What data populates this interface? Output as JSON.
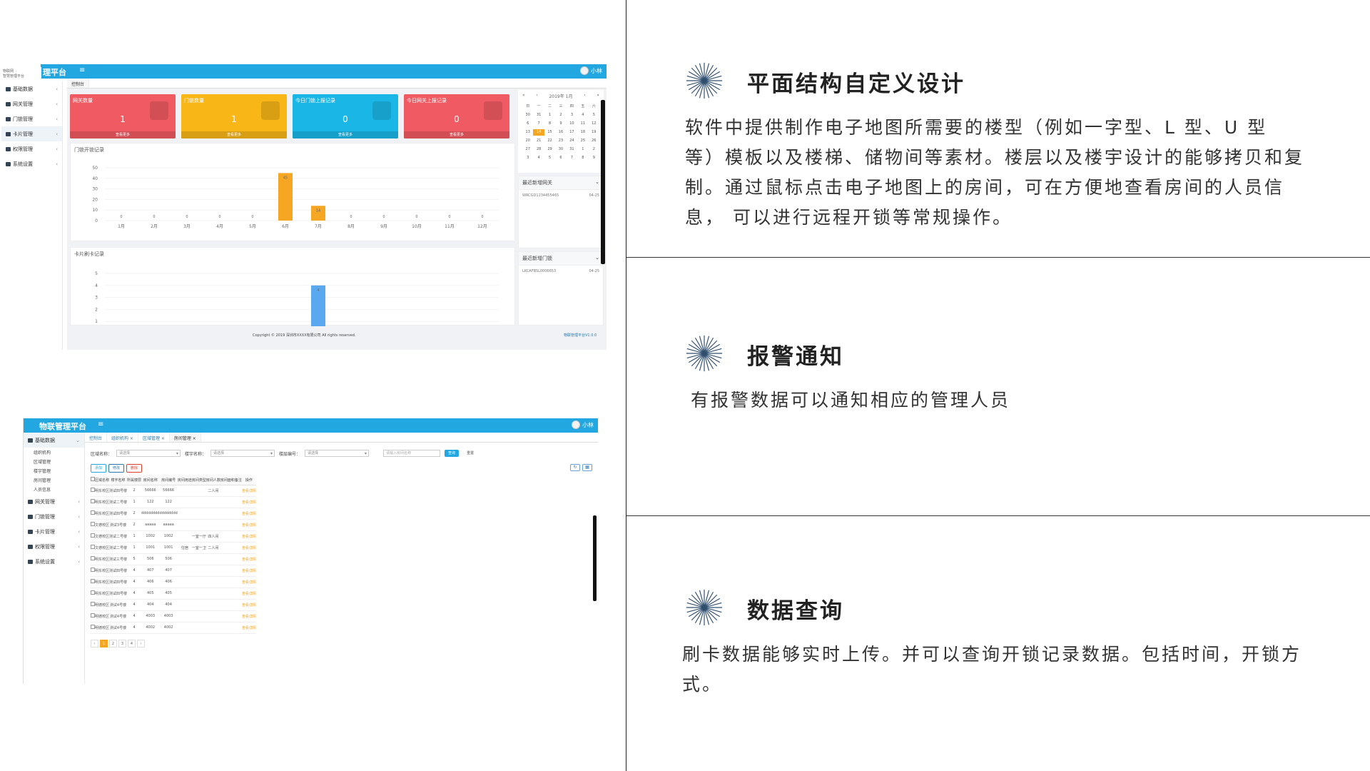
{
  "dashboard": {
    "brand": "理平台",
    "logo_line1": "物联网",
    "logo_line2": "智慧管理平台",
    "menu_toggle": "≡",
    "user": "小林",
    "sidebar": [
      "基础数据",
      "网关管理",
      "门锁管理",
      "卡片管理",
      "权限管理",
      "系统设置"
    ],
    "tab": "控制台",
    "cards": [
      {
        "title": "网关数量",
        "value": "1",
        "footer": "查看更多",
        "color": "#f05a62"
      },
      {
        "title": "门锁数量",
        "value": "1",
        "footer": "查看更多",
        "color": "#f8b617"
      },
      {
        "title": "今日门锁上报记录",
        "value": "0",
        "footer": "查看更多",
        "color": "#1ab7e6"
      },
      {
        "title": "今日网关上报记录",
        "value": "0",
        "footer": "查看更多",
        "color": "#f05a62"
      }
    ],
    "chart1": {
      "title": "门锁开锁记录",
      "type": "bar",
      "categories": [
        "1月",
        "2月",
        "3月",
        "4月",
        "5月",
        "6月",
        "7月",
        "8月",
        "9月",
        "10月",
        "11月",
        "12月"
      ],
      "values": [
        0,
        0,
        0,
        0,
        0,
        45,
        14,
        0,
        0,
        0,
        0,
        0
      ],
      "yticks": [
        "50",
        "40",
        "30",
        "20",
        "10",
        "0"
      ],
      "ylim": [
        0,
        50
      ],
      "color": "#f5a623"
    },
    "chart2": {
      "title": "卡片刷卡记录",
      "type": "bar",
      "values": [
        0,
        0,
        0,
        0,
        0,
        0,
        4,
        0,
        0,
        0,
        0,
        0
      ],
      "yticks": [
        "5",
        "4",
        "3",
        "2",
        "1"
      ],
      "ylim": [
        0,
        5
      ],
      "color": "#5aa9f0"
    },
    "calendar": {
      "month": "2019年 1月",
      "weekdays": [
        "日",
        "一",
        "二",
        "三",
        "四",
        "五",
        "六"
      ],
      "days": [
        "30",
        "31",
        "1",
        "2",
        "3",
        "4",
        "5",
        "6",
        "7",
        "8",
        "9",
        "10",
        "11",
        "12",
        "13",
        "14",
        "15",
        "16",
        "17",
        "18",
        "19",
        "20",
        "21",
        "22",
        "23",
        "24",
        "25",
        "26",
        "27",
        "28",
        "29",
        "30",
        "31",
        "1",
        "2",
        "3",
        "4",
        "5",
        "6",
        "7",
        "8",
        "9"
      ],
      "today_index": 15
    },
    "recent_gateway": {
      "title": "最近新增网关",
      "item": "WRCGD1234455465",
      "time": "04-25"
    },
    "recent_lock": {
      "title": "最近新增门锁",
      "item": "LKCAFBSL0006653",
      "time": "04-25"
    },
    "copyright": "Copyright © 2019 深圳市XXXX有限公司 All rights reserved.",
    "version": "物联管理平台V1.0.0"
  },
  "roomlist": {
    "brand": "物联管理平台",
    "menu_toggle": "≡",
    "user": "小林",
    "sidebar": {
      "group": "基础数据",
      "subs": [
        "组织机构",
        "区域管理",
        "楼宇管理",
        "房间管理",
        "人员信息"
      ],
      "items": [
        "网关管理",
        "门锁管理",
        "卡片管理",
        "权限管理",
        "系统设置"
      ]
    },
    "tabs": [
      "控制台",
      "组织机构 ×",
      "区域管理 ×",
      "房间管理 ×"
    ],
    "filters": {
      "area_label": "区域名称：",
      "area_value": "请选择",
      "building_label": "楼宇名称：",
      "building_value": "请选择",
      "floor_label": "楼层编号：",
      "floor_value": "请选择",
      "room_placeholder": "请输入房间名称",
      "query": "查询",
      "reset": "重置"
    },
    "actions": {
      "add": "添加",
      "edit": "修改",
      "delete": "删除"
    },
    "columns": [
      "",
      "区域名称",
      "楼宇名称",
      "所属楼层",
      "房间名称",
      "房间编号",
      "房间用途",
      "房间类型",
      "房间人数",
      "房间面积",
      "备注",
      "操作"
    ],
    "rows": [
      [
        "明东校区",
        "测试四号楼",
        "2",
        "56666",
        "56666",
        "",
        "",
        "二人间",
        "",
        "",
        "查看详情"
      ],
      [
        "明东校区",
        "测试二号楼",
        "1",
        "122",
        "122",
        "",
        "",
        "",
        "",
        "",
        "查看详情"
      ],
      [
        "明东校区",
        "测试四号楼",
        "2",
        "dddddddd",
        "dddddddd",
        "",
        "",
        "",
        "",
        "",
        "查看详情"
      ],
      [
        "文德校区",
        "测试3号楼",
        "2",
        "aaaaa",
        "aaaaa",
        "",
        "",
        "",
        "",
        "",
        "查看详情"
      ],
      [
        "文德校区",
        "测试二号楼",
        "1",
        "1002",
        "1002",
        "",
        "一室一厅",
        "四人间",
        "",
        "",
        "查看详情"
      ],
      [
        "文德校区",
        "测试二号楼",
        "1",
        "1001",
        "1001",
        "住宿",
        "一室一卫",
        "二人间",
        "",
        "",
        "查看详情"
      ],
      [
        "明东校区",
        "测试三号楼",
        "5",
        "506",
        "506",
        "",
        "",
        "",
        "",
        "",
        "查看详情"
      ],
      [
        "明东校区",
        "测试四号楼",
        "4",
        "407",
        "407",
        "",
        "",
        "",
        "",
        "",
        "查看详情"
      ],
      [
        "明东校区",
        "测试四号楼",
        "4",
        "406",
        "406",
        "",
        "",
        "",
        "",
        "",
        "查看详情"
      ],
      [
        "明东校区",
        "测试四号楼",
        "4",
        "405",
        "405",
        "",
        "",
        "",
        "",
        "",
        "查看详情"
      ],
      [
        "明德校区",
        "测试4号楼",
        "4",
        "404",
        "404",
        "",
        "",
        "",
        "",
        "",
        "查看详情"
      ],
      [
        "明德校区",
        "测试4号楼",
        "4",
        "4003",
        "4003",
        "",
        "",
        "",
        "",
        "",
        "查看详情"
      ],
      [
        "明德校区",
        "测试4号楼",
        "4",
        "4002",
        "4002",
        "",
        "",
        "",
        "",
        "",
        "查看详情"
      ]
    ],
    "pages": [
      "‹",
      "1",
      "2",
      "3",
      "4",
      "›"
    ]
  },
  "features": [
    {
      "title": "平面结构自定义设计",
      "body": "软件中提供制作电子地图所需要的楼型（例如一字型、L 型、U 型 等）模板以及楼梯、储物间等素材。楼层以及楼宇设计的能够拷贝和复制。通过鼠标点击电子地图上的房间，可在方便地查看房间的人员信息， 可以进行远程开锁等常规操作。"
    },
    {
      "title": "报警通知",
      "body": "有报警数据可以通知相应的管理人员"
    },
    {
      "title": "数据查询",
      "body": "刷卡数据能够实时上传。并可以查询开锁记录数据。包括时间，开锁方式。"
    }
  ],
  "colors": {
    "accent": "#22a7e0",
    "orange": "#f5a623",
    "red": "#f05a62",
    "yellow": "#f8b617",
    "cyan": "#1ab7e6"
  }
}
